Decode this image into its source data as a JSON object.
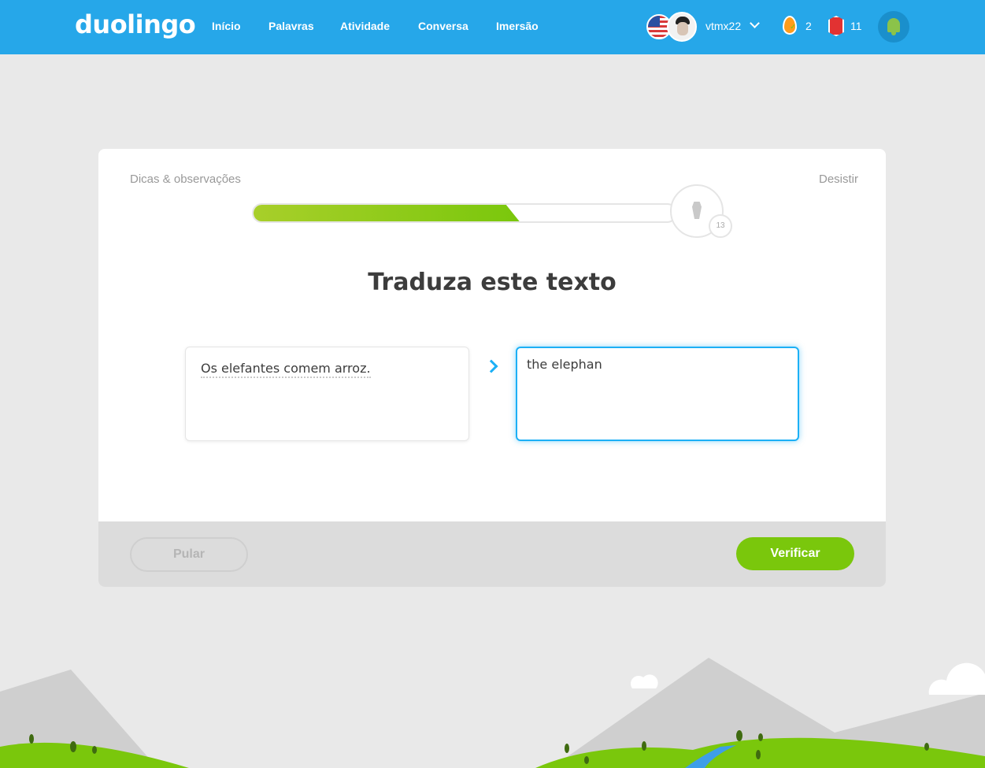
{
  "header": {
    "logo": "duolingo",
    "nav": [
      "Início",
      "Palavras",
      "Atividade",
      "Conversa",
      "Imersão"
    ],
    "username": "vtmx22",
    "streak_count": "2",
    "gems_count": "11",
    "brand_color": "#26a7e9"
  },
  "lesson": {
    "hints_label": "Dicas & observações",
    "quit_label": "Desistir",
    "progress_fraction": 0.63,
    "trophy_badge": "13",
    "prompt_title": "Traduza este texto",
    "source_sentence": "Os elefantes comem arroz.",
    "answer_value": "the elephan",
    "skip_label": "Pular",
    "check_label": "Verificar",
    "accent_color": "#7ac70c",
    "input_focus_color": "#1cb0f6"
  }
}
